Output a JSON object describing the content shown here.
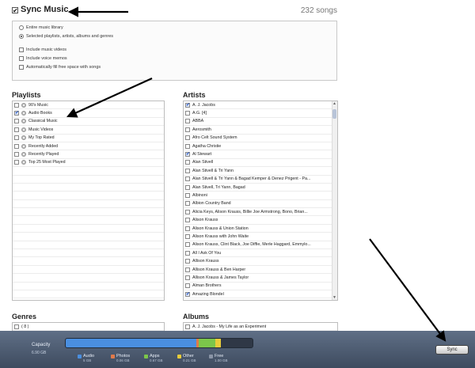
{
  "header": {
    "title": "Sync Music",
    "checked": true,
    "song_count": "232 songs"
  },
  "options": {
    "entire_library": "Entire music library",
    "selected": "Selected playlists, artists, albums and genres",
    "include_videos": "Include music videos",
    "include_memos": "Include voice memos",
    "autofill": "Automatically fill free space with songs"
  },
  "playlists": {
    "heading": "Playlists",
    "items": [
      {
        "label": "90's Music",
        "checked": false
      },
      {
        "label": "Audio Books",
        "checked": true
      },
      {
        "label": "Classical Music",
        "checked": false
      },
      {
        "label": "Music Videos",
        "checked": false
      },
      {
        "label": "My Top Rated",
        "checked": false
      },
      {
        "label": "Recently Added",
        "checked": false
      },
      {
        "label": "Recently Played",
        "checked": false
      },
      {
        "label": "Top 25 Most Played",
        "checked": false
      }
    ]
  },
  "artists": {
    "heading": "Artists",
    "items": [
      {
        "label": "A. J. Jacobs",
        "checked": true
      },
      {
        "label": "A.G. [4]",
        "checked": false
      },
      {
        "label": "ABBA",
        "checked": false
      },
      {
        "label": "Aerosmith",
        "checked": false
      },
      {
        "label": "Afro Celt Sound System",
        "checked": false
      },
      {
        "label": "Agatha Christie",
        "checked": false
      },
      {
        "label": "Al Stewart",
        "checked": true
      },
      {
        "label": "Alan Stivell",
        "checked": false
      },
      {
        "label": "Alan Stivell & Tri Yann",
        "checked": false
      },
      {
        "label": "Alan Stivell & Tri Yann & Bagad Kemper & Denez Prigent - Pa...",
        "checked": false
      },
      {
        "label": "Alan Stivell, Tri Yann, Bagad",
        "checked": false
      },
      {
        "label": "Albinoni",
        "checked": false
      },
      {
        "label": "Albion Country Band",
        "checked": false
      },
      {
        "label": "Alicia Keys, Alison Krauss, Billie Joe Armstrong, Bono, Brian...",
        "checked": false
      },
      {
        "label": "Alison Krauss",
        "checked": false
      },
      {
        "label": "Alison Krauss & Union Station",
        "checked": false
      },
      {
        "label": "Alison Krauss with John Waite",
        "checked": false
      },
      {
        "label": "Alison Krauss, Clint Black, Joe Diffie, Merle Haggard, Emmylo...",
        "checked": false
      },
      {
        "label": "All I Ask Of You",
        "checked": false
      },
      {
        "label": "Allison Krauss",
        "checked": false
      },
      {
        "label": "Allison Krauss & Ben Harper",
        "checked": false
      },
      {
        "label": "Allison Krauss & James Taylor",
        "checked": false
      },
      {
        "label": "Alman Brothers",
        "checked": false
      },
      {
        "label": "Amazing Blondel",
        "checked": true
      }
    ]
  },
  "genres": {
    "heading": "Genres",
    "items": [
      {
        "label": "( 8 )",
        "checked": false
      }
    ]
  },
  "albums": {
    "heading": "Albums",
    "items": [
      {
        "label": "A. J. Jacobs - My Life as an Experiment",
        "checked": false
      }
    ]
  },
  "capacity": {
    "label": "Capacity",
    "total": "6.90 GB",
    "segments": [
      {
        "name": "Audio",
        "value": "5 GB",
        "color": "#4a8fe0",
        "fraction": 0.7
      },
      {
        "name": "Photos",
        "value": "0.06 GB",
        "color": "#e07a4a",
        "fraction": 0.01
      },
      {
        "name": "Apps",
        "value": "0.67 GB",
        "color": "#7cc64a",
        "fraction": 0.09
      },
      {
        "name": "Other",
        "value": "0.21 GB",
        "color": "#e8cc3a",
        "fraction": 0.03
      },
      {
        "name": "Free",
        "value": "1.00 GB",
        "color": "#2f3846",
        "fraction": 0.17
      }
    ]
  },
  "sync_button": "Sync"
}
